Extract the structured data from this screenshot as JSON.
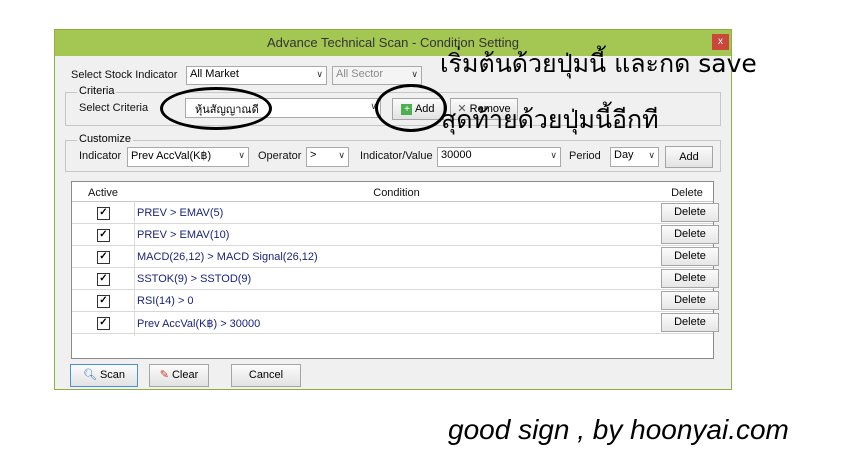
{
  "window": {
    "title": "Advance Technical Scan - Condition Setting",
    "close_label": "x"
  },
  "stock": {
    "label": "Select Stock Indicator",
    "market_value": "All Market",
    "sector_value": "All Sector"
  },
  "criteria": {
    "group_title": "Criteria",
    "label": "Select Criteria",
    "value": "หุ้นสัญญาณดี",
    "add_label": "Add",
    "remove_label": "Remove"
  },
  "customize": {
    "group_title": "Customize",
    "indicator_label": "Indicator",
    "indicator_value": "Prev AccVal(K฿)",
    "operator_label": "Operator",
    "operator_value": ">",
    "value_label": "Indicator/Value",
    "value_value": "30000",
    "period_label": "Period",
    "period_value": "Day",
    "add_label": "Add"
  },
  "grid": {
    "headers": {
      "active": "Active",
      "condition": "Condition",
      "delete": "Delete"
    },
    "rows": [
      {
        "checked": true,
        "condition": "PREV > EMAV(5)",
        "delete": "Delete"
      },
      {
        "checked": true,
        "condition": "PREV > EMAV(10)",
        "delete": "Delete"
      },
      {
        "checked": true,
        "condition": "MACD(26,12) > MACD Signal(26,12)",
        "delete": "Delete"
      },
      {
        "checked": true,
        "condition": "SSTOK(9) > SSTOD(9)",
        "delete": "Delete"
      },
      {
        "checked": true,
        "condition": "RSI(14) > 0",
        "delete": "Delete"
      },
      {
        "checked": true,
        "condition": "Prev AccVal(K฿) > 30000",
        "delete": "Delete"
      }
    ]
  },
  "footer": {
    "scan_label": "Scan",
    "clear_label": "Clear",
    "cancel_label": "Cancel"
  },
  "overlay": {
    "line1": "เริ่มต้นด้วยปุ่มนี้ และกด save",
    "line2": "สุดท้ายด้วยปุ่มนี้อีกที",
    "signature": "good sign , by hoonyai.com"
  },
  "colors": {
    "titlebar": "#a4c753",
    "close": "#c9483a",
    "condition_text": "#1a237e"
  },
  "icons": {
    "scan": "magnifier-icon",
    "clear": "clear-icon",
    "add": "add-green-icon",
    "remove": "remove-icon",
    "check": "check-icon"
  }
}
